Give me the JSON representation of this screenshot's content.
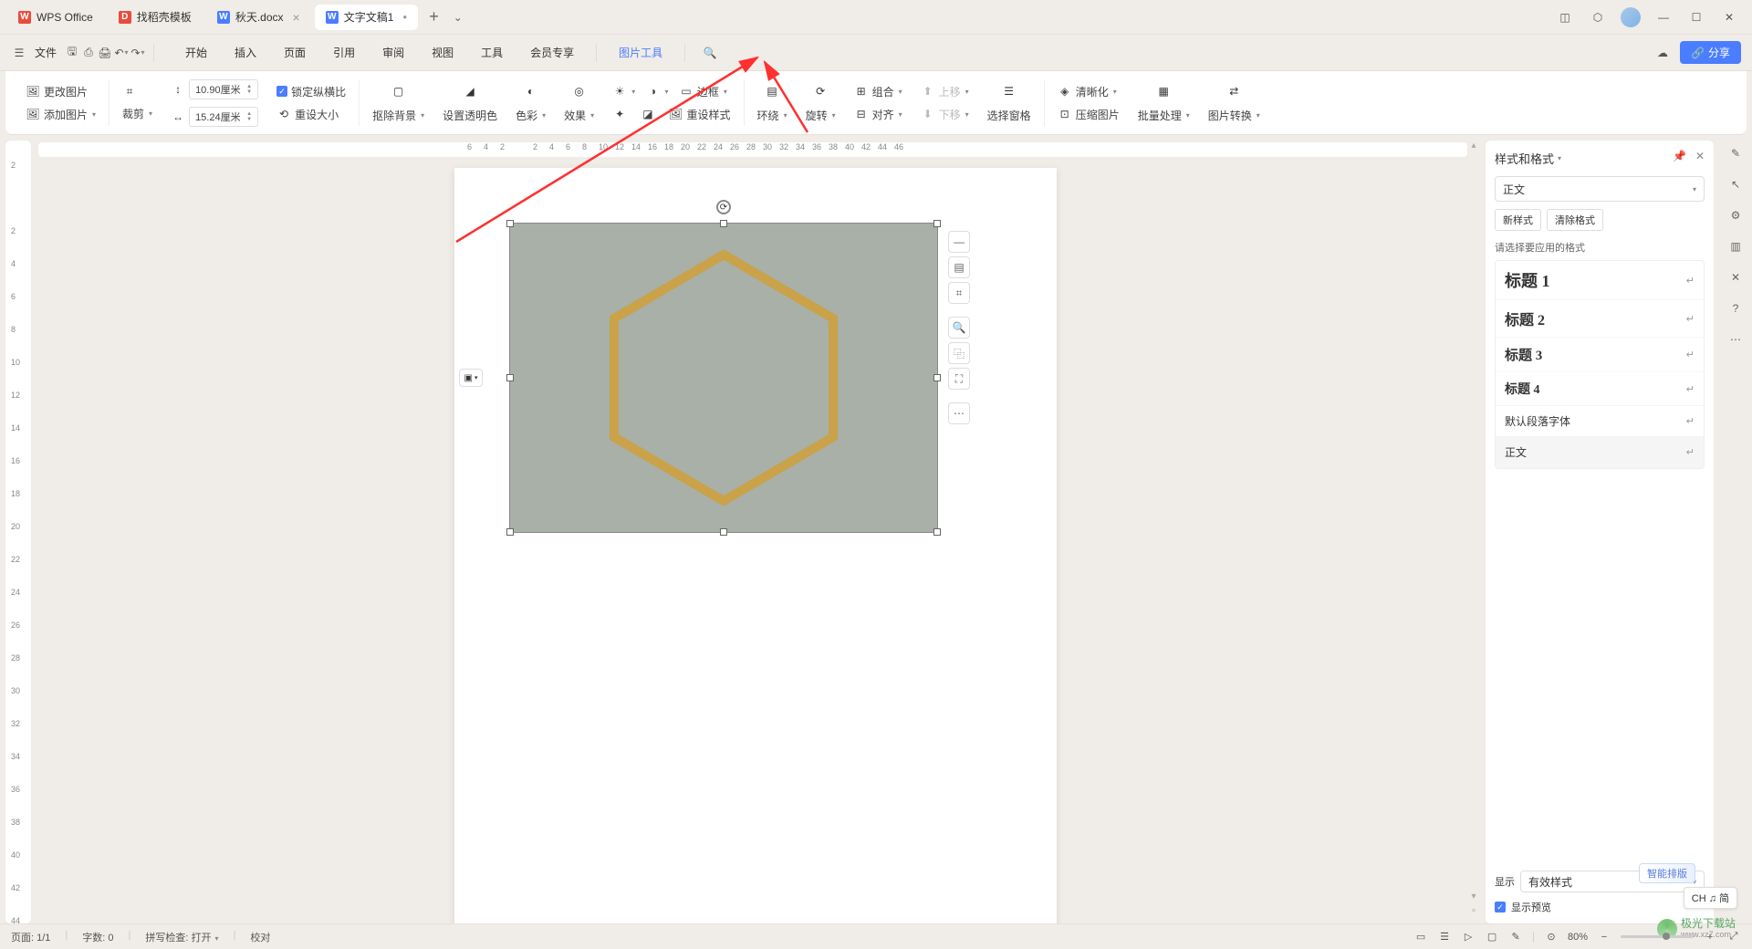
{
  "titlebar": {
    "app": "WPS Office",
    "tabs": [
      {
        "label": "找稻壳模板",
        "icon_bg": "#e84c3d",
        "icon_txt": "D"
      },
      {
        "label": "秋天.docx",
        "icon_bg": "#4a7dff",
        "icon_txt": "W"
      },
      {
        "label": "文字文稿1",
        "icon_bg": "#4a7dff",
        "icon_txt": "W",
        "active": true
      }
    ]
  },
  "menubar": {
    "file": "文件",
    "tabs": [
      "开始",
      "插入",
      "页面",
      "引用",
      "审阅",
      "视图",
      "工具",
      "会员专享",
      "图片工具"
    ],
    "active": "图片工具",
    "share": "分享"
  },
  "ribbon": {
    "change_pic": "更改图片",
    "add_pic": "添加图片",
    "crop": "裁剪",
    "height": "10.90厘米",
    "width": "15.24厘米",
    "lock_ratio": "锁定纵横比",
    "reset_size": "重设大小",
    "remove_bg": "抠除背景",
    "set_transparent": "设置透明色",
    "color": "色彩",
    "effect": "效果",
    "border": "边框",
    "reset_style": "重设样式",
    "wrap": "环绕",
    "rotate": "旋转",
    "group": "组合",
    "align": "对齐",
    "up": "上移",
    "down": "下移",
    "sel_pane": "选择窗格",
    "clarity": "清晰化",
    "compress": "压缩图片",
    "batch": "批量处理",
    "convert": "图片转换"
  },
  "hruler": [
    "6",
    "4",
    "2",
    "",
    "2",
    "4",
    "6",
    "8",
    "10",
    "12",
    "14",
    "16",
    "18",
    "20",
    "22",
    "24",
    "26",
    "28",
    "30",
    "32",
    "34",
    "36",
    "38",
    "40",
    "42",
    "44",
    "46"
  ],
  "vruler": [
    "2",
    "",
    "2",
    "4",
    "6",
    "8",
    "10",
    "12",
    "14",
    "16",
    "18",
    "20",
    "22",
    "24",
    "26",
    "28",
    "30",
    "32",
    "34",
    "36",
    "38",
    "40",
    "42",
    "44"
  ],
  "right_panel": {
    "title": "样式和格式",
    "current": "正文",
    "new_style": "新样式",
    "clear_fmt": "清除格式",
    "apply_hint": "请选择要应用的格式",
    "styles": [
      {
        "name": "标题 1",
        "cls": "h1"
      },
      {
        "name": "标题 2",
        "cls": "h2"
      },
      {
        "name": "标题 3",
        "cls": "h3"
      },
      {
        "name": "标题 4",
        "cls": "h4"
      },
      {
        "name": "默认段落字体",
        "cls": "def"
      },
      {
        "name": "正文",
        "cls": "def",
        "sel": true
      }
    ],
    "show": "显示",
    "show_val": "有效样式",
    "preview": "显示预览",
    "smart": "智能排版"
  },
  "status": {
    "page": "页面: 1/1",
    "words": "字数: 0",
    "spell": "拼写检查: 打开",
    "proof": "校对",
    "zoom": "80%"
  },
  "ime": "CH ♫ 简",
  "watermark": {
    "brand": "极光下载站",
    "url": "www.xz7.com"
  }
}
